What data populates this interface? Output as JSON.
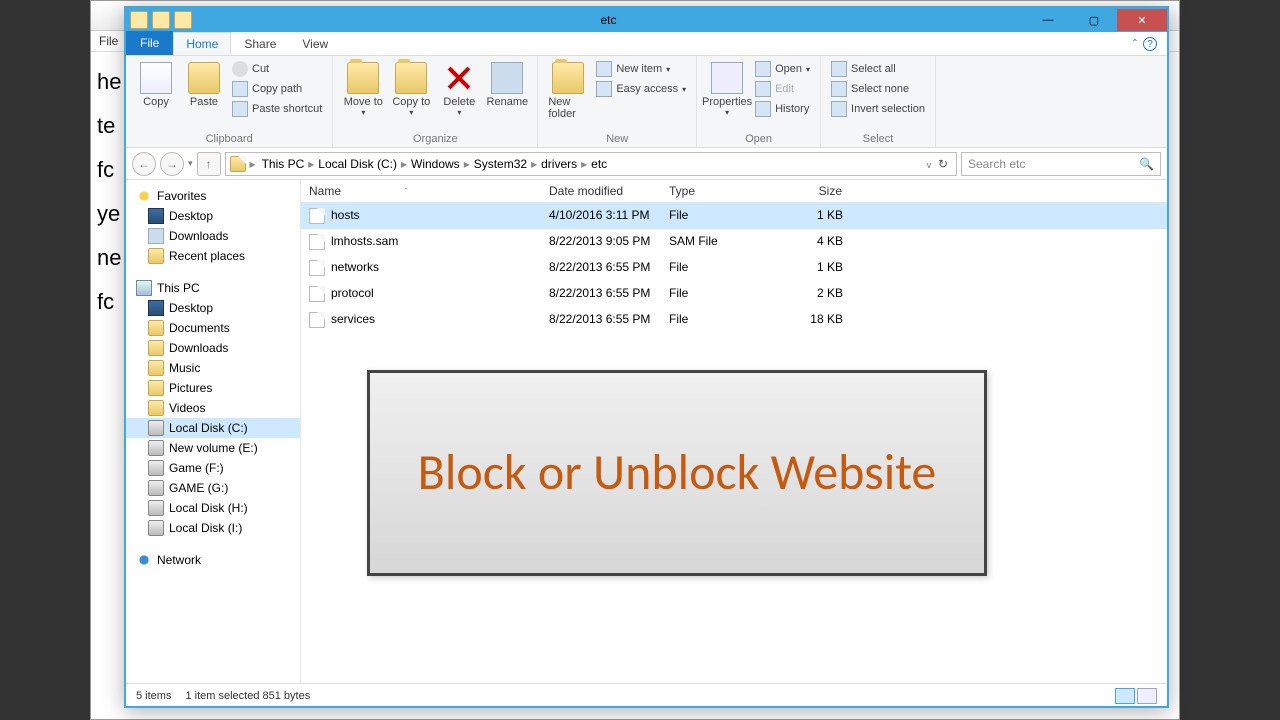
{
  "bg_menu": "File",
  "bg_lines": [
    "he",
    "te",
    "fc",
    "ye",
    "ne",
    "fc"
  ],
  "title": "etc",
  "ribbon": {
    "file": "File",
    "tabs": [
      "Home",
      "Share",
      "View"
    ],
    "clipboard": {
      "title": "Clipboard",
      "copy": "Copy",
      "paste": "Paste",
      "cut": "Cut",
      "copypath": "Copy path",
      "pasteshortcut": "Paste shortcut"
    },
    "organize": {
      "title": "Organize",
      "moveto": "Move to",
      "copyto": "Copy to",
      "delete": "Delete",
      "rename": "Rename"
    },
    "new": {
      "title": "New",
      "newfolder": "New folder",
      "newitem": "New item",
      "easyaccess": "Easy access"
    },
    "open": {
      "title": "Open",
      "properties": "Properties",
      "open": "Open",
      "edit": "Edit",
      "history": "History"
    },
    "select": {
      "title": "Select",
      "all": "Select all",
      "none": "Select none",
      "invert": "Invert selection"
    }
  },
  "breadcrumb": [
    "This PC",
    "Local Disk (C:)",
    "Windows",
    "System32",
    "drivers",
    "etc"
  ],
  "search_placeholder": "Search etc",
  "columns": {
    "name": "Name",
    "date": "Date modified",
    "type": "Type",
    "size": "Size"
  },
  "files": [
    {
      "name": "hosts",
      "date": "4/10/2016 3:11 PM",
      "type": "File",
      "size": "1 KB",
      "sel": true
    },
    {
      "name": "lmhosts.sam",
      "date": "8/22/2013 9:05 PM",
      "type": "SAM File",
      "size": "4 KB",
      "sel": false
    },
    {
      "name": "networks",
      "date": "8/22/2013 6:55 PM",
      "type": "File",
      "size": "1 KB",
      "sel": false
    },
    {
      "name": "protocol",
      "date": "8/22/2013 6:55 PM",
      "type": "File",
      "size": "2 KB",
      "sel": false
    },
    {
      "name": "services",
      "date": "8/22/2013 6:55 PM",
      "type": "File",
      "size": "18 KB",
      "sel": false
    }
  ],
  "nav": {
    "favorites": "Favorites",
    "fav_items": [
      "Desktop",
      "Downloads",
      "Recent places"
    ],
    "thispc": "This PC",
    "pc_items": [
      {
        "label": "Desktop",
        "ico": "ni-mon"
      },
      {
        "label": "Documents",
        "ico": "ni-folder"
      },
      {
        "label": "Downloads",
        "ico": "ni-folder"
      },
      {
        "label": "Music",
        "ico": "ni-folder"
      },
      {
        "label": "Pictures",
        "ico": "ni-folder"
      },
      {
        "label": "Videos",
        "ico": "ni-folder"
      },
      {
        "label": "Local Disk (C:)",
        "ico": "ni-drive",
        "sel": true
      },
      {
        "label": "New volume (E:)",
        "ico": "ni-drive"
      },
      {
        "label": "Game (F:)",
        "ico": "ni-drive"
      },
      {
        "label": "GAME (G:)",
        "ico": "ni-drive"
      },
      {
        "label": "Local Disk (H:)",
        "ico": "ni-drive"
      },
      {
        "label": "Local Disk (I:)",
        "ico": "ni-drive"
      }
    ],
    "network": "Network"
  },
  "status": {
    "count": "5 items",
    "selection": "1 item selected  851 bytes"
  },
  "overlay_text": "Block or Unblock Website"
}
